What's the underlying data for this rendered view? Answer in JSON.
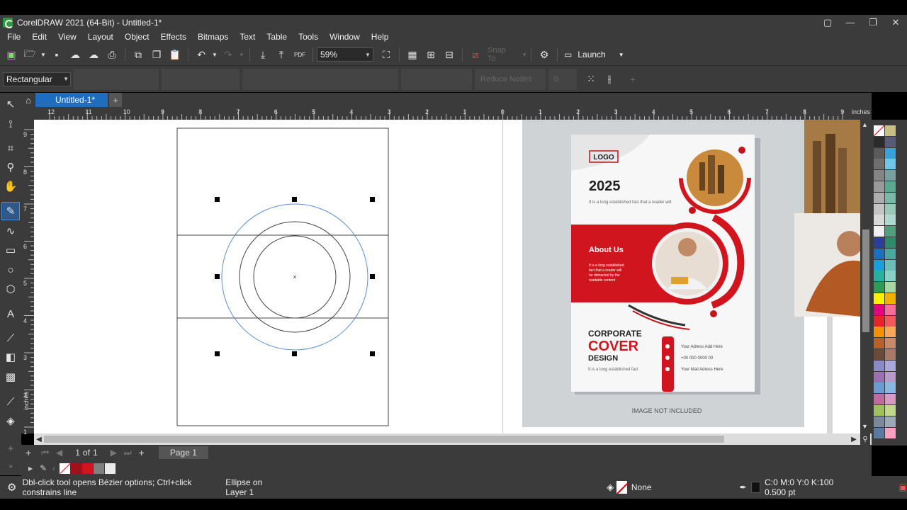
{
  "window": {
    "title": "CorelDRAW 2021 (64-Bit) - Untitled-1*",
    "controls": [
      "▢",
      "—",
      "❐",
      "✕"
    ]
  },
  "menu": [
    "File",
    "Edit",
    "View",
    "Layout",
    "Object",
    "Effects",
    "Bitmaps",
    "Text",
    "Table",
    "Tools",
    "Window",
    "Help"
  ],
  "toolbar": {
    "zoom": "59%",
    "snap_label": "Snap To",
    "launch_label": "Launch",
    "pdf_label": "PDF"
  },
  "property_bar": {
    "shape_mode": "Rectangular",
    "reduce_nodes": "Reduce Nodes",
    "node_count": "0"
  },
  "tabs": {
    "document": "Untitled-1*"
  },
  "ruler": {
    "unit": "inches",
    "h_labels": [
      "12",
      "11",
      "10",
      "9",
      "8",
      "7",
      "6",
      "5",
      "4",
      "3",
      "2",
      "1",
      "0",
      "1",
      "2",
      "3",
      "4",
      "5",
      "6",
      "7",
      "8",
      "9"
    ],
    "v_labels": [
      "9",
      "8",
      "7",
      "6",
      "5",
      "4",
      "3",
      "2",
      "1"
    ]
  },
  "cover": {
    "logo": "LOGO",
    "year": "2025",
    "tagline": "It is a long established fact that a reader will",
    "about_title": "About Us",
    "about_text": [
      "It is a long established",
      "fact that a reader will",
      "be distracted by the",
      "readable content"
    ],
    "headline_1": "CORPORATE",
    "headline_2": "COVER",
    "headline_3": "DESIGN",
    "headline_sub": "It is a long established fact",
    "contact_address": "Your Adress Add Here",
    "contact_phone": "+00 000 0000 00",
    "contact_email": "Your Mail Adress Here",
    "caption": "IMAGE NOT INCLUDED"
  },
  "page_nav": {
    "current": "1",
    "of": "of",
    "total": "1",
    "page_tab": "Page 1"
  },
  "status": {
    "hint": "Dbl-click tool opens Bézier options; Ctrl+click constrains line",
    "object": "Ellipse on Layer 1",
    "fill": "None",
    "outline": "C:0 M:0 Y:0 K:100  0.500 pt"
  },
  "colors": {
    "chrome": "#3b3b3b",
    "accent_blue": "#1e6dbf",
    "brand_red": "#d1151e"
  }
}
